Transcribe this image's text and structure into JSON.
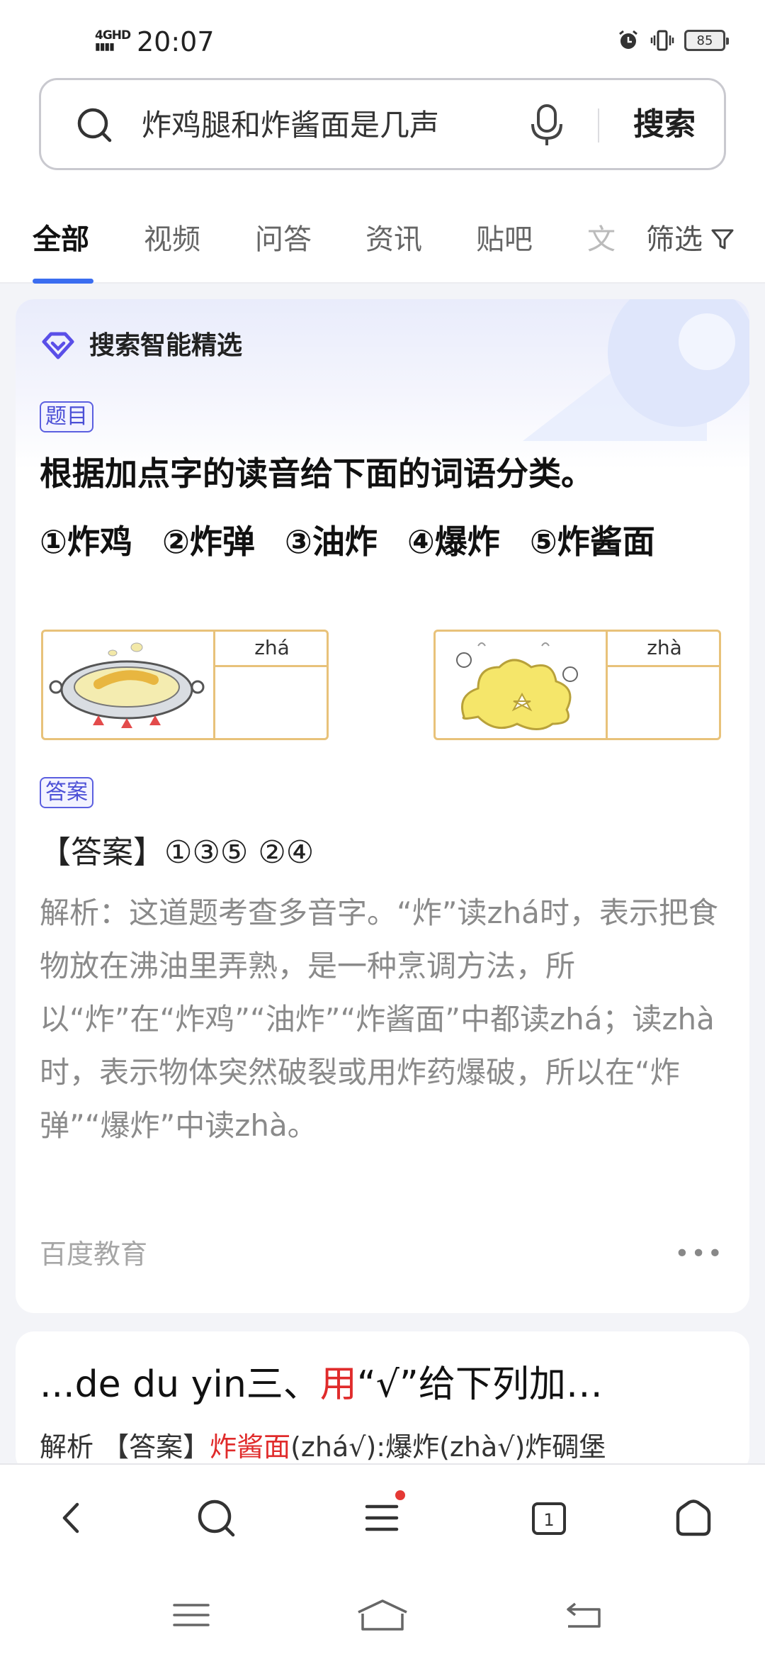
{
  "status_bar": {
    "network": "4GHD",
    "time": "20:07",
    "battery": "85",
    "icons": [
      "alarm-icon",
      "vibrate-icon",
      "battery-icon"
    ]
  },
  "search": {
    "query": "炸鸡腿和炸酱面是几声",
    "button_label": "搜索",
    "icons": [
      "search-icon",
      "mic-icon"
    ]
  },
  "tabs": {
    "items": [
      {
        "label": "全部",
        "active": true
      },
      {
        "label": "视频",
        "active": false
      },
      {
        "label": "问答",
        "active": false
      },
      {
        "label": "资讯",
        "active": false
      },
      {
        "label": "贴吧",
        "active": false
      },
      {
        "label": "文",
        "active": false
      }
    ],
    "filter_label": "筛选",
    "accent": "#3b6df0"
  },
  "card1": {
    "brand": "搜索智能精选",
    "question_tag": "题目",
    "question_title": "根据加点字的读音给下面的词语分类。",
    "items": [
      "①炸鸡",
      "②炸弹",
      "③油炸",
      "④爆炸",
      "⑤炸酱面"
    ],
    "image_left_pinyin": "zhá",
    "image_right_pinyin": "zhà",
    "answer_tag": "答案",
    "answer_line": "【答案】①③⑤ ②④",
    "analysis": "解析：这道题考查多音字。“炸”读zhá时，表示把食物放在沸油里弄熟，是一种烹调方法，所以“炸”在“炸鸡”“油炸”“炸酱面”中都读zhá；读zhà时，表示物体突然破裂或用炸药爆破，所以在“炸弹”“爆炸”中读zhà。",
    "source": "百度教育",
    "more": "•••"
  },
  "card2": {
    "title_prefix": "...de du yin三、",
    "title_red": "用",
    "title_suffix": "“√”给下列加…",
    "snippet_prefix": "解析 【答案】",
    "snippet_red": "炸酱面",
    "snippet_suffix": "(zhá√):爆炸(zhà√)炸碉堡"
  },
  "bottom_nav": {
    "items": [
      "back-icon",
      "search-icon",
      "menu-icon",
      "tabs-icon",
      "home-icon"
    ],
    "tab_count": "1",
    "badge_color": "#e53935"
  },
  "system_nav": {
    "items": [
      "recent-apps-icon",
      "home-icon",
      "back-icon"
    ]
  }
}
